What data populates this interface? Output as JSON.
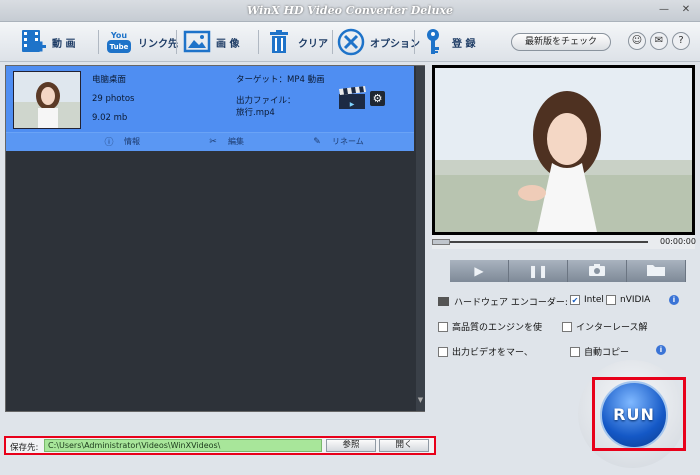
{
  "window": {
    "title": "WinX HD Video Converter Deluxe"
  },
  "toolbar": {
    "video_label": "動 画",
    "youtube_label": "リンク先",
    "youtube_logo": "YouTube",
    "image_label": "画 像",
    "clear_label": "クリア",
    "options_label": "オプション",
    "register_label": "登 録",
    "update_label": "最新版をチェック"
  },
  "file": {
    "name": "电脑桌面",
    "photos": "29 photos",
    "size": "9.02 mb",
    "target": "ターゲット：MP4 動画",
    "output_label": "出力ファイル：",
    "output_name": "旅行.mp4"
  },
  "actions": {
    "info": "情報",
    "edit": "編集",
    "rename": "リネーム"
  },
  "save": {
    "label": "保存先:",
    "path": "C:\\Users\\Administrator\\Videos\\WinXVideos\\",
    "browse": "参照",
    "open": "開く"
  },
  "preview": {
    "timecode": "00:00:00"
  },
  "options": {
    "hw_encoder": "ハードウェア エンコーダー:",
    "intel": "Intel",
    "nvidia": "nVIDIA",
    "high_quality": "高品質のエンジンを使",
    "deinterlace": "インターレース解",
    "output_video": "出力ビデオをマー、",
    "auto_copy": "自動コピー"
  },
  "run": {
    "label": "RUN"
  },
  "colors": {
    "accent": "#4f8ef2",
    "highlight": "#e8001a",
    "path_bg": "#a8e69a"
  }
}
